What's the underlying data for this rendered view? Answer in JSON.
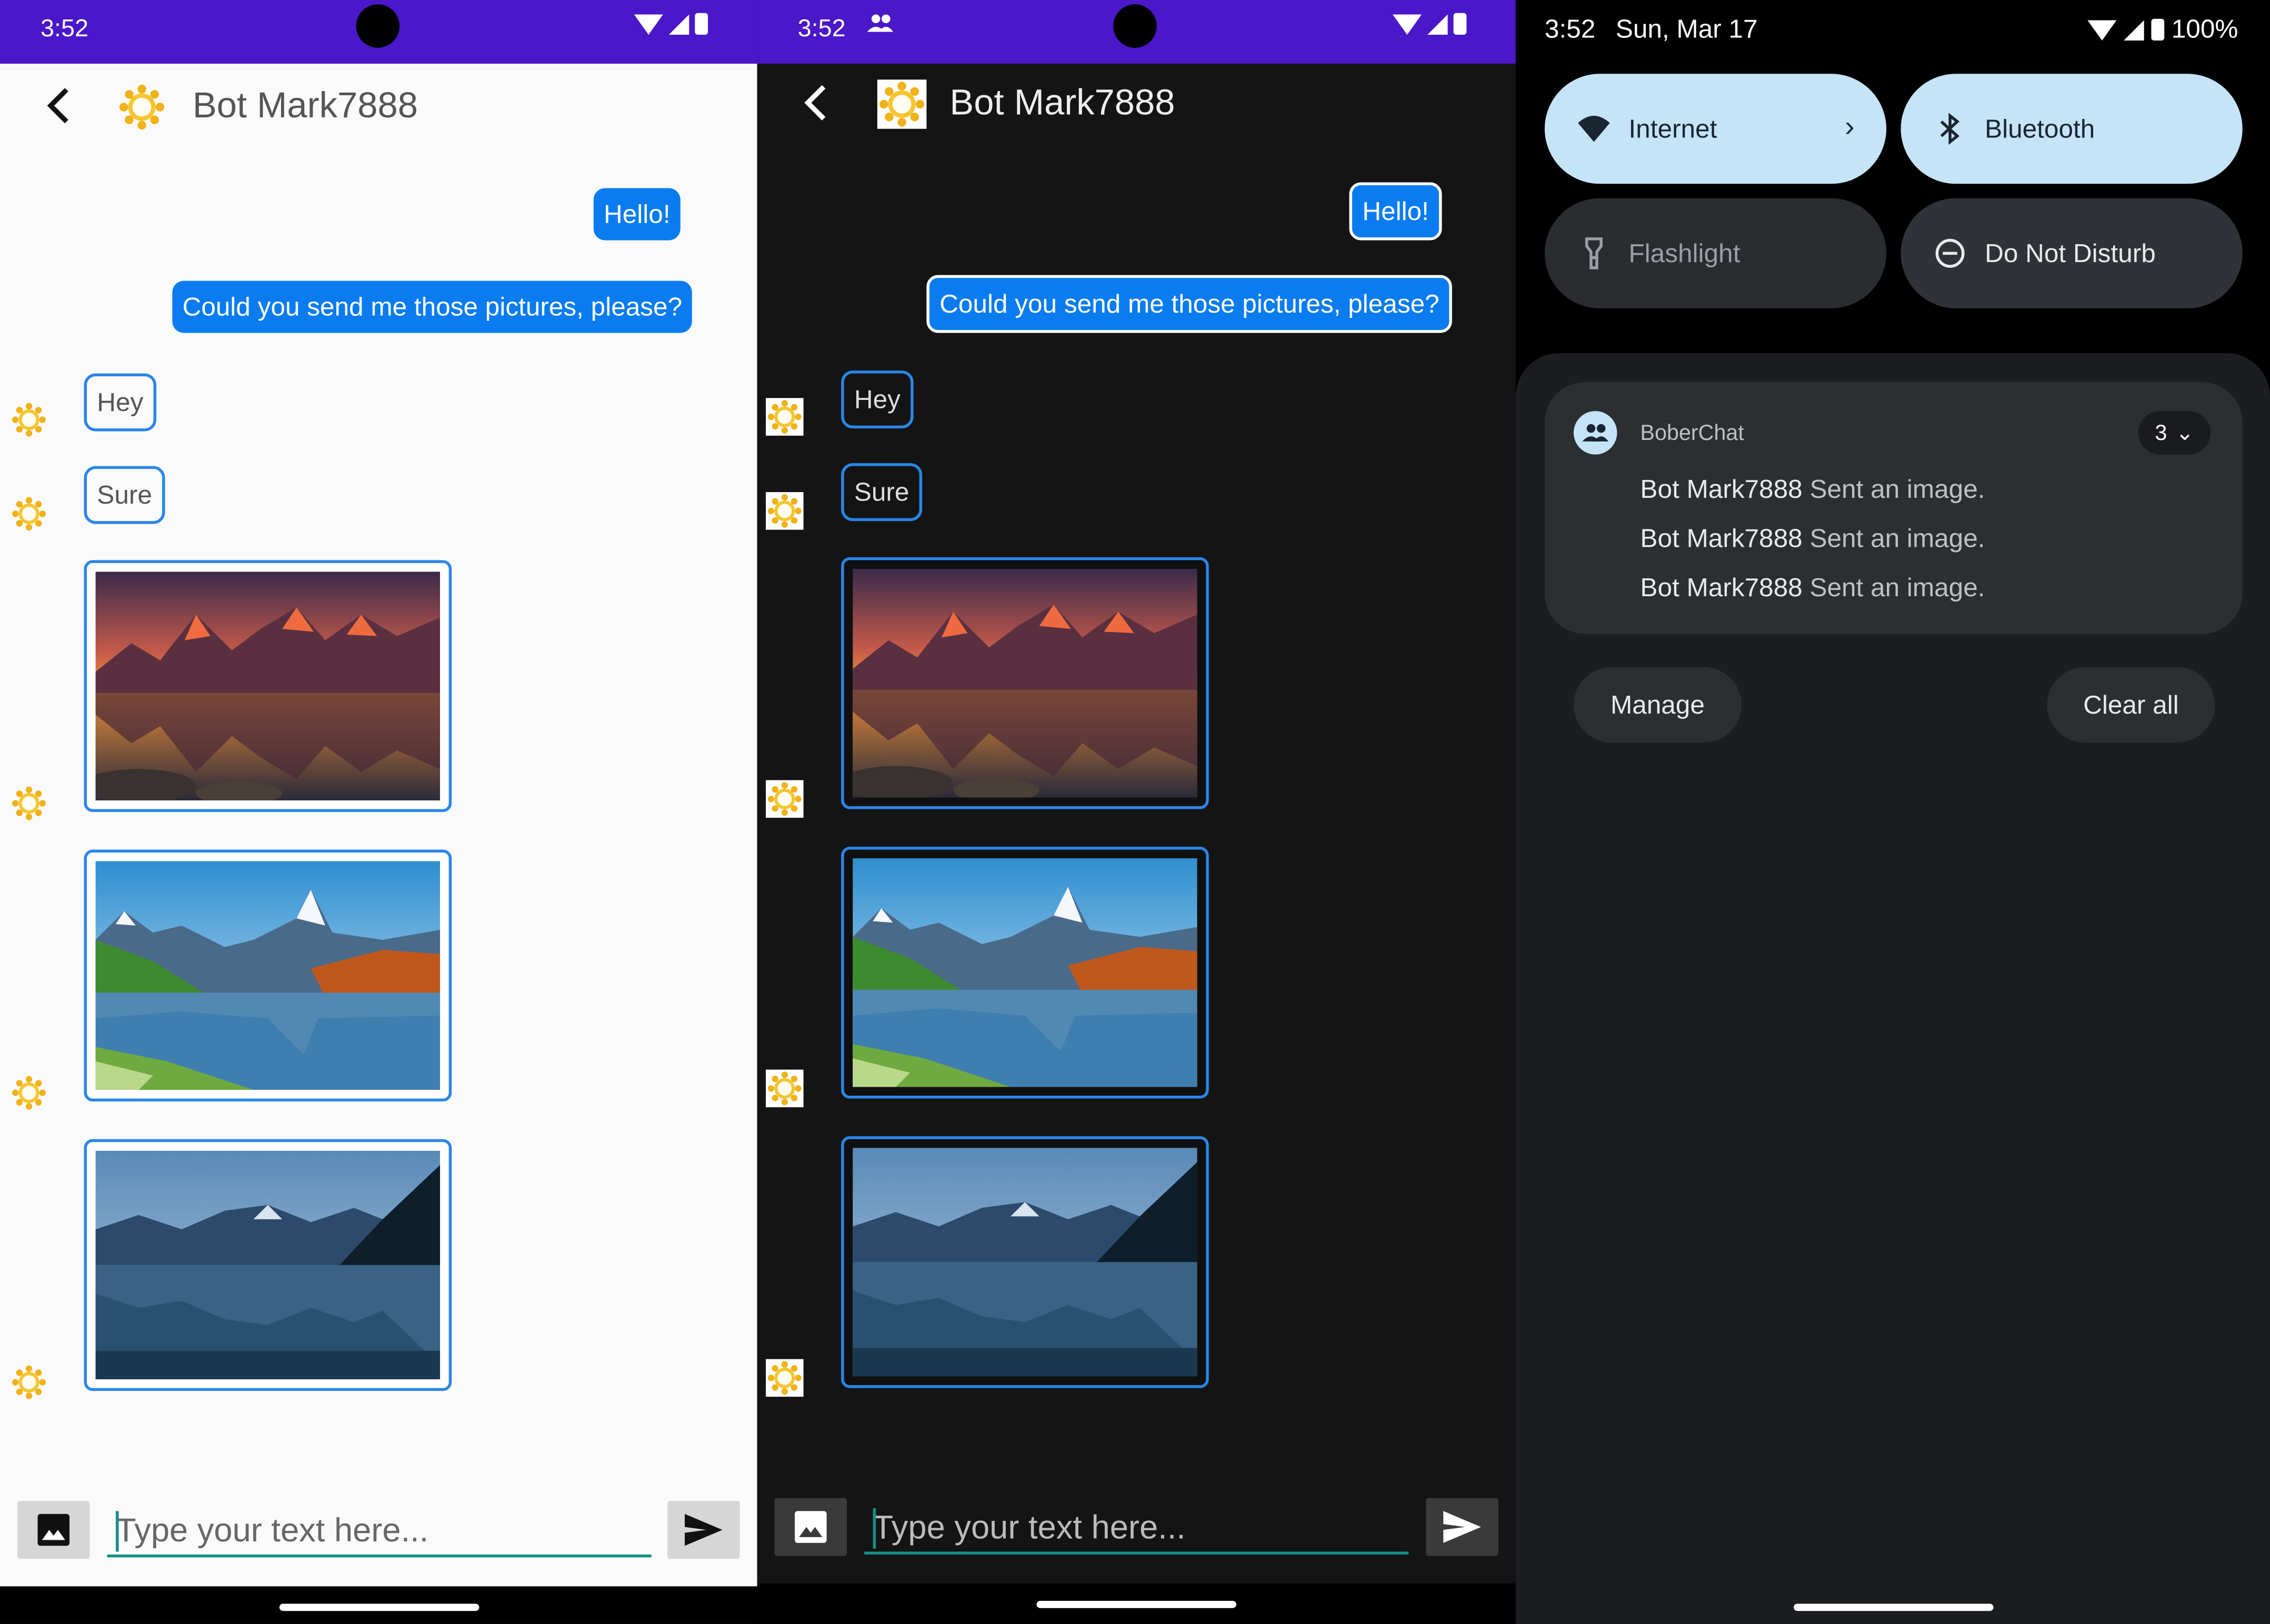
{
  "colors": {
    "status_bar": "#4a17c9",
    "my_bubble": "#0a7cf0",
    "bubble_border": "#2a86e8",
    "input_underline": "#158f85",
    "tile_active": "#c5e4f8",
    "tile_inactive": "#2a2c30"
  },
  "light": {
    "status": {
      "time": "3:52"
    },
    "header": {
      "title": "Bot Mark7888",
      "avatar_icon": "sun-icon"
    },
    "messages": {
      "m1": "Hello!",
      "m2": "Could you send me those pictures, please?",
      "m3": "Hey",
      "m4": "Sure"
    },
    "images": [
      "mountain-sunset-lake",
      "alpine-meadow-lake",
      "blue-mountain-lake"
    ],
    "composer": {
      "placeholder": "Type your text here..."
    }
  },
  "dark": {
    "status": {
      "time": "3:52"
    },
    "header": {
      "title": "Bot Mark7888",
      "avatar_icon": "sun-icon"
    },
    "messages": {
      "m1": "Hello!",
      "m2": "Could you send me those pictures, please?",
      "m3": "Hey",
      "m4": "Sure"
    },
    "images": [
      "mountain-sunset-lake",
      "alpine-meadow-lake",
      "blue-mountain-lake"
    ],
    "composer": {
      "placeholder": "Type your text here..."
    }
  },
  "shade": {
    "time": "3:52",
    "date": "Sun, Mar 17",
    "battery": "100%",
    "tiles": {
      "internet": "Internet",
      "bluetooth": "Bluetooth",
      "flashlight": "Flashlight",
      "dnd": "Do Not Disturb"
    },
    "notification": {
      "app": "BoberChat",
      "count": "3",
      "lines": [
        {
          "sender": "Bot Mark7888",
          "text": "Sent an image."
        },
        {
          "sender": "Bot Mark7888",
          "text": "Sent an image."
        },
        {
          "sender": "Bot Mark7888",
          "text": "Sent an image."
        }
      ]
    },
    "buttons": {
      "manage": "Manage",
      "clear_all": "Clear all"
    }
  }
}
